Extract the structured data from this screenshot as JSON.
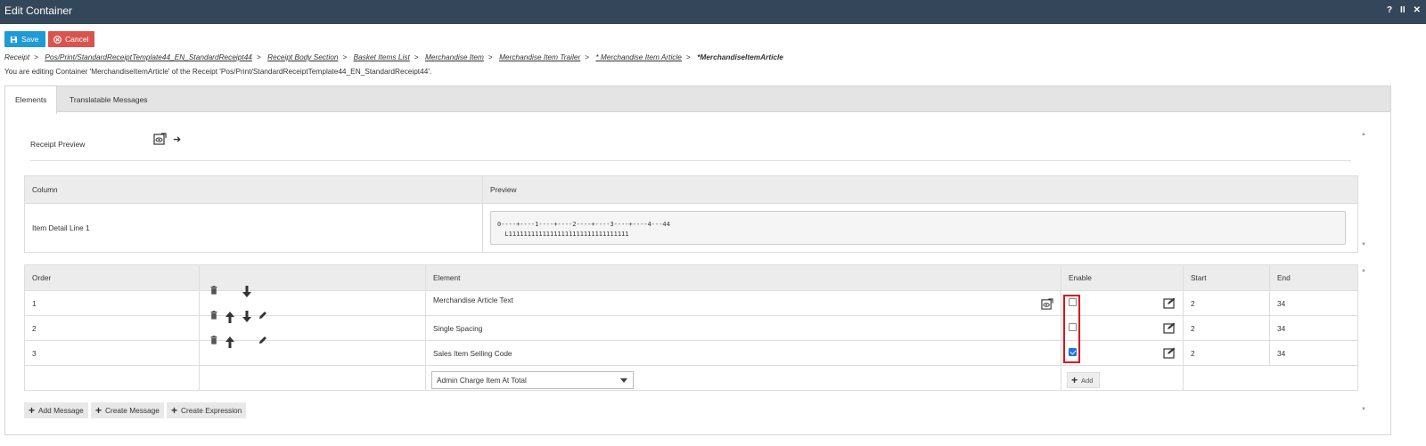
{
  "window": {
    "title": "Edit Container",
    "help": "?",
    "pause": "II",
    "close": "✕"
  },
  "toolbar": {
    "save_label": "Save",
    "cancel_label": "Cancel"
  },
  "breadcrumb": {
    "items": [
      "Receipt",
      "Pos/Print/StandardReceiptTemplate44_EN_StandardReceipt44",
      "Receipt Body Section",
      "Basket Items List",
      "Merchandise Item",
      "Merchandise Item Trailer",
      "* Merchandise Item Article",
      "*MerchandiseItemArticle"
    ],
    "separator": ">"
  },
  "editing_text": "You are editing Container 'MerchandiseItemArticle' of the Receipt 'Pos/Print/StandardReceiptTemplate44_EN_StandardReceipt44'.",
  "tabs": [
    {
      "label": "Elements"
    },
    {
      "label": "Translatable Messages"
    }
  ],
  "receipt_preview": {
    "label": "Receipt Preview"
  },
  "preview_table": {
    "headers": {
      "column": "Column",
      "preview": "Preview"
    },
    "row": {
      "column": "Item Detail Line 1",
      "preview_line1": "0----+----1----+----2----+----3----+----4---44",
      "preview_line2": "  L11111111111111111111111111111111"
    }
  },
  "elements_table": {
    "headers": {
      "order": "Order",
      "actions": "",
      "element": "Element",
      "enable": "Enable",
      "start": "Start",
      "end": "End"
    },
    "rows": [
      {
        "order": "1",
        "element": "Merchandise Article Text",
        "enabled": false,
        "start": "2",
        "end": "34"
      },
      {
        "order": "2",
        "element": "Single Spacing",
        "enabled": false,
        "start": "2",
        "end": "34"
      },
      {
        "order": "3",
        "element": "Sales Item Selling Code",
        "enabled": true,
        "start": "2",
        "end": "34"
      }
    ],
    "new_element_select": "Admin Charge Item At Total",
    "add_label": "Add"
  },
  "bottom_buttons": {
    "add_message": "Add Message",
    "create_message": "Create Message",
    "create_expression": "Create Expression"
  },
  "colors": {
    "titlebar": "#34465a",
    "save": "#1e9ad6",
    "cancel": "#d9534f",
    "highlight": "#e0101a",
    "checkbox": "#1a73e8"
  }
}
